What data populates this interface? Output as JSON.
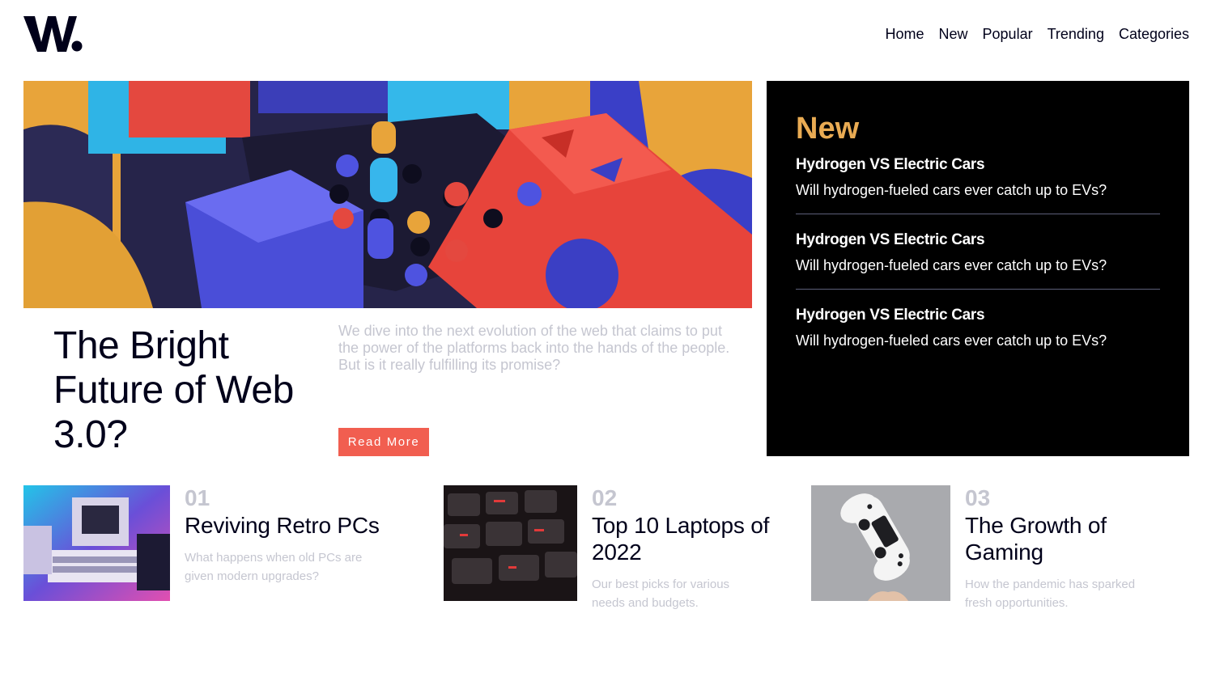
{
  "brand": {
    "logo_text": "W."
  },
  "nav": {
    "items": [
      "Home",
      "New",
      "Popular",
      "Trending",
      "Categories"
    ]
  },
  "hero": {
    "title": "The Bright Future of Web 3.0?",
    "description": "We dive into the next evolution of the web that claims to put the power of the platforms back into the hands of the people. But is it really fulfilling its promise?",
    "button_label": "Read More"
  },
  "new_panel": {
    "heading": "New",
    "items": [
      {
        "title": "Hydrogen VS Electric Cars",
        "description": "Will hydrogen-fueled cars ever catch up to EVs?"
      },
      {
        "title": "Hydrogen VS Electric Cars",
        "description": "Will hydrogen-fueled cars ever catch up to EVs?"
      },
      {
        "title": "Hydrogen VS Electric Cars",
        "description": "Will hydrogen-fueled cars ever catch up to EVs?"
      }
    ]
  },
  "articles": [
    {
      "number": "01",
      "title": "Reviving Retro PCs",
      "description": "What happens when old PCs are given modern upgrades?",
      "image": "retro-pc-image"
    },
    {
      "number": "02",
      "title": "Top 10 Laptops of 2022",
      "description": "Our best picks for various needs and budgets.",
      "image": "keyboard-image"
    },
    {
      "number": "03",
      "title": "The Growth of Gaming",
      "description": "How the pandemic has sparked fresh opportunities.",
      "image": "game-controller-image"
    }
  ],
  "colors": {
    "accent_orange": "#e9ab53",
    "accent_red": "#f15e50",
    "dark": "#00001a",
    "muted": "#c5c6d0"
  }
}
